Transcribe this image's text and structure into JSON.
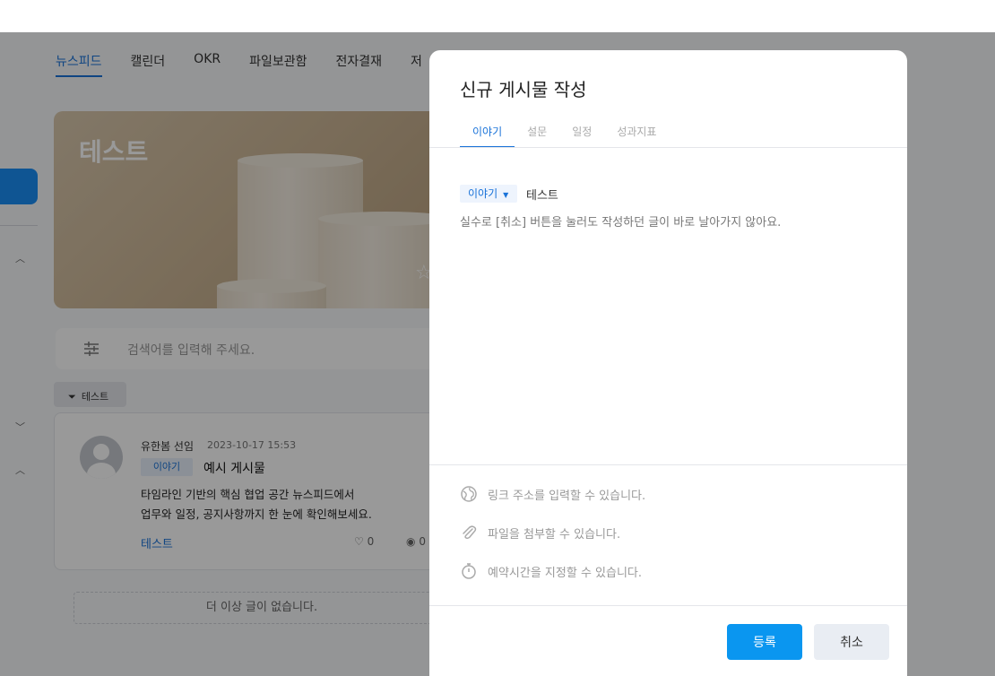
{
  "nav": {
    "items": [
      "뉴스피드",
      "캘린더",
      "OKR",
      "파일보관함",
      "전자결재",
      "저"
    ]
  },
  "hero": {
    "title": "테스트"
  },
  "search": {
    "placeholder": "검색어를 입력해 주세요."
  },
  "filter": {
    "label": "테스트"
  },
  "post": {
    "author": "유한봄 선임",
    "date": "2023-10-17 15:53",
    "tag": "이야기",
    "title": "예시 게시물",
    "body_line1": "타임라인 기반의 핵심 협업 공간 뉴스피드에서",
    "body_line2": "업무와 일정, 공지사항까지 한 눈에 확인해보세요.",
    "link": "테스트",
    "likes": "0",
    "views": "0"
  },
  "feed": {
    "no_more": "더 이상 글이 없습니다."
  },
  "modal": {
    "title": "신규 게시물 작성",
    "tabs": [
      "이야기",
      "설문",
      "일정",
      "성과지표"
    ],
    "compose_tag": "이야기",
    "compose_title": "테스트",
    "hint": "실수로 [취소] 버튼을 눌러도 작성하던 글이 바로 날아가지 않아요.",
    "link_option": "링크 주소를 입력할 수 있습니다.",
    "file_option": "파일을 첨부할 수 있습니다.",
    "schedule_option": "예약시간을 지정할 수 있습니다.",
    "submit_label": "등록",
    "cancel_label": "취소"
  },
  "colors": {
    "accent": "#1a73d9",
    "primary_button": "#0a96f0",
    "overlay": "rgba(0,0,0,0.4)"
  }
}
